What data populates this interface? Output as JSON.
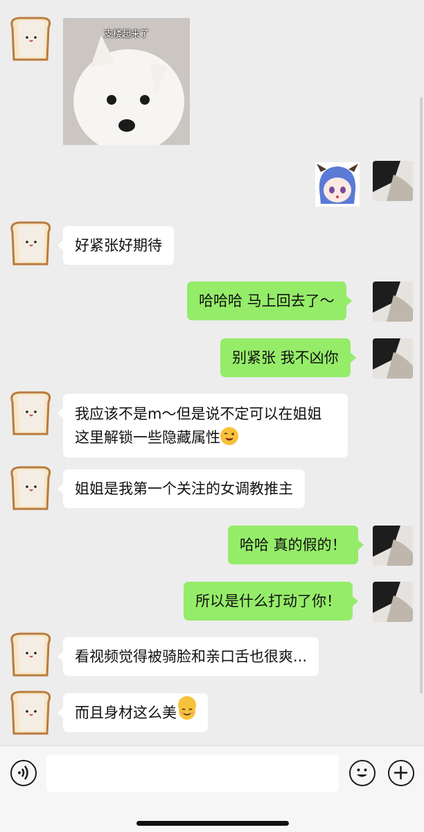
{
  "colors": {
    "background": "#ededed",
    "incoming_bubble": "#ffffff",
    "outgoing_bubble": "#95ec69",
    "input_bar": "#f6f6f6"
  },
  "messages": [
    {
      "id": 0,
      "side": "left",
      "type": "sticker",
      "caption": "支楼起来了",
      "icon": "samoyed-puppy-sticker"
    },
    {
      "id": 1,
      "side": "right",
      "type": "sticker",
      "icon": "anime-girl-sticker"
    },
    {
      "id": 2,
      "side": "left",
      "type": "text",
      "text": "好紧张好期待"
    },
    {
      "id": 3,
      "side": "right",
      "type": "text",
      "text": "哈哈哈 马上回去了～"
    },
    {
      "id": 4,
      "side": "right",
      "type": "text",
      "text": "别紧张 我不凶你"
    },
    {
      "id": 5,
      "side": "left",
      "type": "text",
      "text": "我应该不是m～但是说不定可以在姐姐这里解锁一些隐藏属性",
      "emoji": "winking-tongue-emoji"
    },
    {
      "id": 6,
      "side": "left",
      "type": "text",
      "text": "姐姐是我第一个关注的女调教推主"
    },
    {
      "id": 7,
      "side": "right",
      "type": "text",
      "text": "哈哈 真的假的！"
    },
    {
      "id": 8,
      "side": "right",
      "type": "text",
      "text": "所以是什么打动了你！"
    },
    {
      "id": 9,
      "side": "left",
      "type": "text",
      "text": "看视频觉得被骑脸和亲口舌也很爽..."
    },
    {
      "id": 10,
      "side": "left",
      "type": "text",
      "text": "而且身材这么美",
      "emoji": "smiling-closed-eyes-emoji"
    }
  ],
  "avatars": {
    "left": "toast-bread-avatar",
    "right": "dark-photo-avatar"
  },
  "input_bar": {
    "placeholder": "",
    "voice_icon": "voice-icon",
    "emoji_icon": "emoji-icon",
    "plus_icon": "plus-icon"
  }
}
